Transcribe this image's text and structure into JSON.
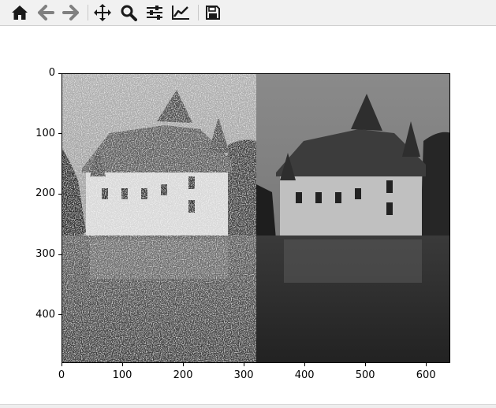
{
  "toolbar": {
    "buttons": [
      {
        "name": "home-icon",
        "tooltip": "Reset original view"
      },
      {
        "name": "back-icon",
        "tooltip": "Back"
      },
      {
        "name": "forward-icon",
        "tooltip": "Forward"
      },
      {
        "name": "pan-icon",
        "tooltip": "Pan"
      },
      {
        "name": "zoom-icon",
        "tooltip": "Zoom"
      },
      {
        "name": "configure-subplots-icon",
        "tooltip": "Configure subplots"
      },
      {
        "name": "edit-axis-icon",
        "tooltip": "Edit axis"
      },
      {
        "name": "save-icon",
        "tooltip": "Save"
      }
    ]
  },
  "figure": {
    "description_panels": [
      "noisy grayscale photo of a château reflected in water",
      "denoised grayscale photo of the same château"
    ],
    "colors": {
      "axes_border": "#000000",
      "toolbar_bg": "#f1f1f1"
    }
  },
  "chart_data": {
    "type": "image",
    "xlim": [
      0,
      640
    ],
    "ylim": [
      480,
      0
    ],
    "x_ticks": [
      "0",
      "100",
      "200",
      "300",
      "400",
      "500",
      "600"
    ],
    "y_ticks": [
      "0",
      "100",
      "200",
      "300",
      "400"
    ],
    "x_tick_values": [
      0,
      100,
      200,
      300,
      400,
      500,
      600
    ],
    "y_tick_values": [
      0,
      100,
      200,
      300,
      400
    ],
    "split_x": 320,
    "title": "",
    "xlabel": "",
    "ylabel": ""
  }
}
